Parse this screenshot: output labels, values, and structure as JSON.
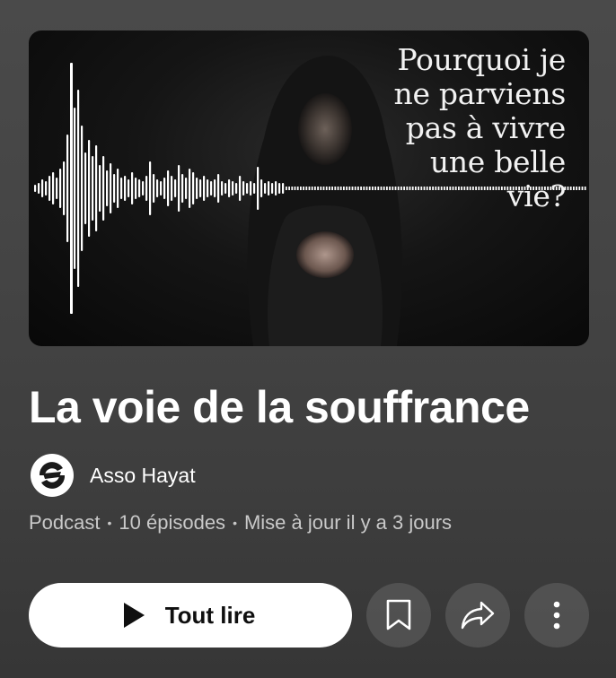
{
  "thumbnail": {
    "overlay_text": "Pourquoi je\nne parviens\npas à vivre\nune belle\nvie?"
  },
  "playlist": {
    "title": "La voie de la souffrance",
    "channel_name": "Asso Hayat",
    "type": "Podcast",
    "episodes": "10 épisodes",
    "updated": "Mise à jour il y a 3 jours",
    "separator": "•"
  },
  "actions": {
    "play_all_label": "Tout lire",
    "save_icon": "bookmark-icon",
    "share_icon": "share-icon",
    "more_icon": "more-vert-icon"
  },
  "colors": {
    "background": "#444444",
    "primary_button": "#ffffff",
    "secondary_button": "#5a5a5a",
    "meta_text": "#c9c9c9"
  }
}
